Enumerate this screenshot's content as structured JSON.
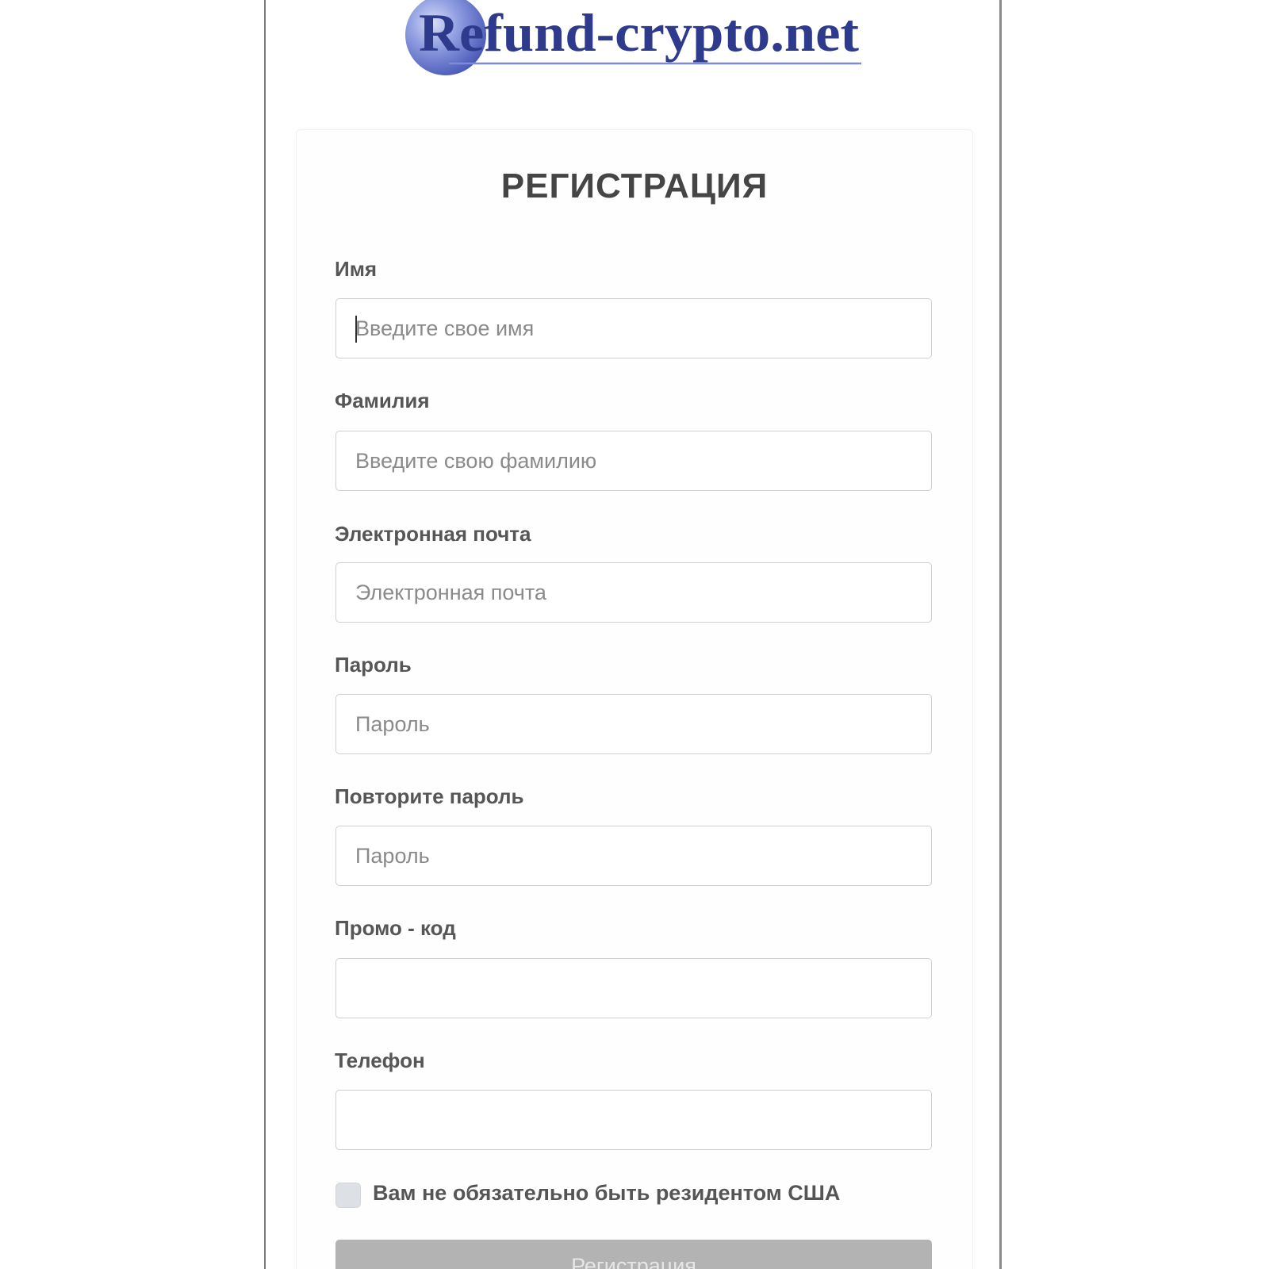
{
  "brand": {
    "logo_text": "Refund-crypto.net",
    "primary_color": "#2e3a8c",
    "accent_color": "#6f7fd0"
  },
  "form": {
    "title": "РЕГИСТРАЦИЯ",
    "fields": [
      {
        "label": "Имя",
        "placeholder": "Введите свое имя",
        "value": ""
      },
      {
        "label": "Фамилия",
        "placeholder": "Введите свою фамилию",
        "value": ""
      },
      {
        "label": "Электронная почта",
        "placeholder": "Электронная почта",
        "value": ""
      },
      {
        "label": "Пароль",
        "placeholder": "Пароль",
        "value": ""
      },
      {
        "label": "Повторите пароль",
        "placeholder": "Пароль",
        "value": ""
      },
      {
        "label": "Промо - код",
        "placeholder": "",
        "value": ""
      },
      {
        "label": "Телефон",
        "placeholder": "",
        "value": ""
      }
    ],
    "checkbox_label": "Вам не обязательно быть резидентом США",
    "checkbox_checked": false,
    "submit_label": "Регистрация"
  }
}
